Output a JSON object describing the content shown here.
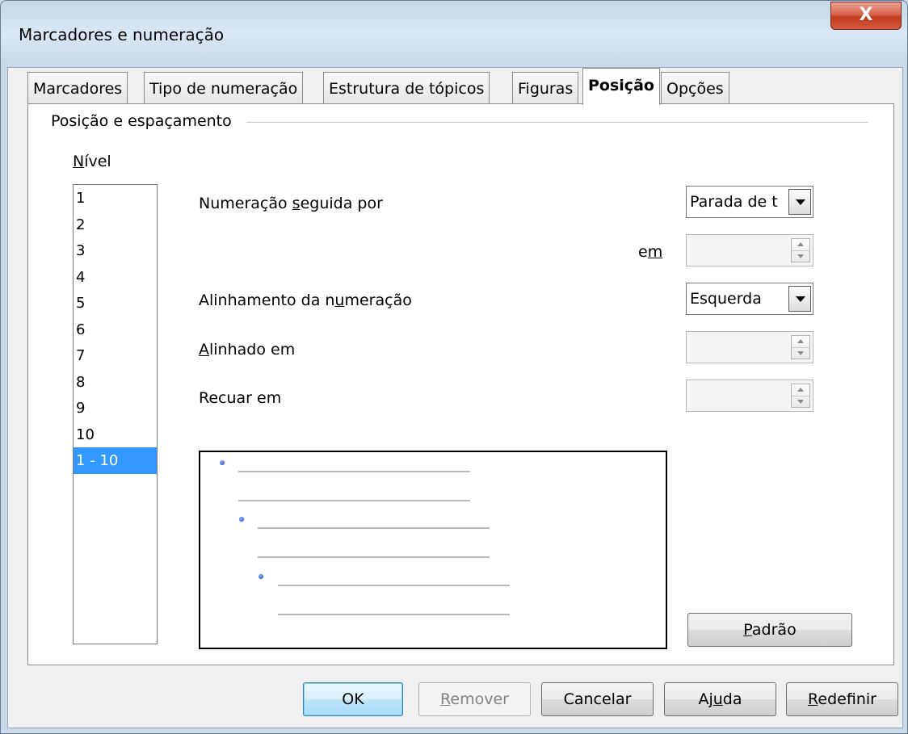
{
  "window": {
    "title": "Marcadores e numeração",
    "close_glyph": "X"
  },
  "tabs": [
    {
      "label": "Marcadores",
      "active": false
    },
    {
      "label": "Tipo de numeração",
      "active": false
    },
    {
      "label": "Estrutura de tópicos",
      "active": false
    },
    {
      "label": "Figuras",
      "active": false
    },
    {
      "label": "Posição",
      "active": true
    },
    {
      "label": "Opções",
      "active": false
    }
  ],
  "position": {
    "group_title": "Posição e espaçamento",
    "level_label_u": "N",
    "level_label_rest": "ível",
    "levels": [
      "1",
      "2",
      "3",
      "4",
      "5",
      "6",
      "7",
      "8",
      "9",
      "10",
      "1 - 10"
    ],
    "selected_level": "1 - 10",
    "numbering_followed_by": {
      "pre": "Numeração ",
      "u": "s",
      "post": "eguida por",
      "value": "Parada de t"
    },
    "at": {
      "pre": "e",
      "u": "m",
      "value": ""
    },
    "numbering_alignment": {
      "pre": "Alinhamento da n",
      "u": "u",
      "post": "meração",
      "value": "Esquerda"
    },
    "aligned_at": {
      "u": "A",
      "post": "linhado em",
      "value": ""
    },
    "indent_at": {
      "label": "Recuar em",
      "value": ""
    },
    "default_button": {
      "u": "P",
      "post": "adrão"
    }
  },
  "buttons": {
    "ok": "OK",
    "remove": {
      "u": "R",
      "post": "emover"
    },
    "cancel": "Cancelar",
    "help": {
      "pre": "Aj",
      "u": "u",
      "post": "da"
    },
    "reset": {
      "u": "R",
      "post": "edefinir"
    }
  },
  "colors": {
    "selection": "#3399ff",
    "close": "#c0391f",
    "bullet": "#1638b8"
  }
}
